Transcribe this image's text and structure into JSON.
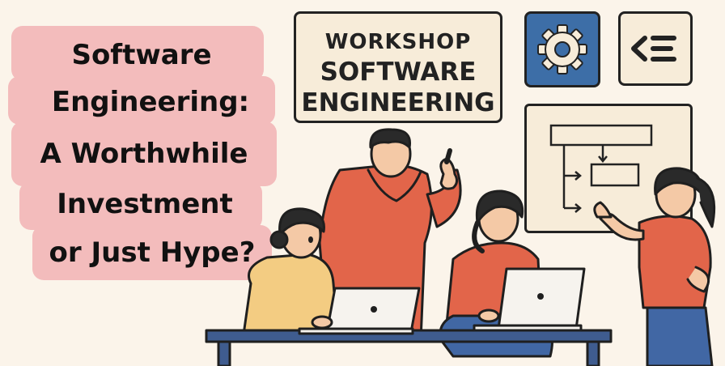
{
  "title": {
    "lines": [
      "Software",
      "Engineering:",
      "A Worthwhile",
      "Investment",
      "or Just Hype?"
    ]
  },
  "sign": {
    "line1": "WORKSHOP",
    "line2": "SOFTWARE",
    "line3": "ENGINEERING"
  },
  "icons": {
    "settings": "gear-icon",
    "code": "code-list-icon",
    "diagram": "flowchart-diagram"
  },
  "colors": {
    "background": "#fbf4ea",
    "title_highlight": "#f3bcbc",
    "gear_tile": "#3d6ea7",
    "shirt_orange": "#e2654a",
    "sweater_yellow": "#f3cc82",
    "jeans_blue": "#4167a4",
    "desk": "#3f5c8f",
    "outline": "#1f1f1f"
  }
}
